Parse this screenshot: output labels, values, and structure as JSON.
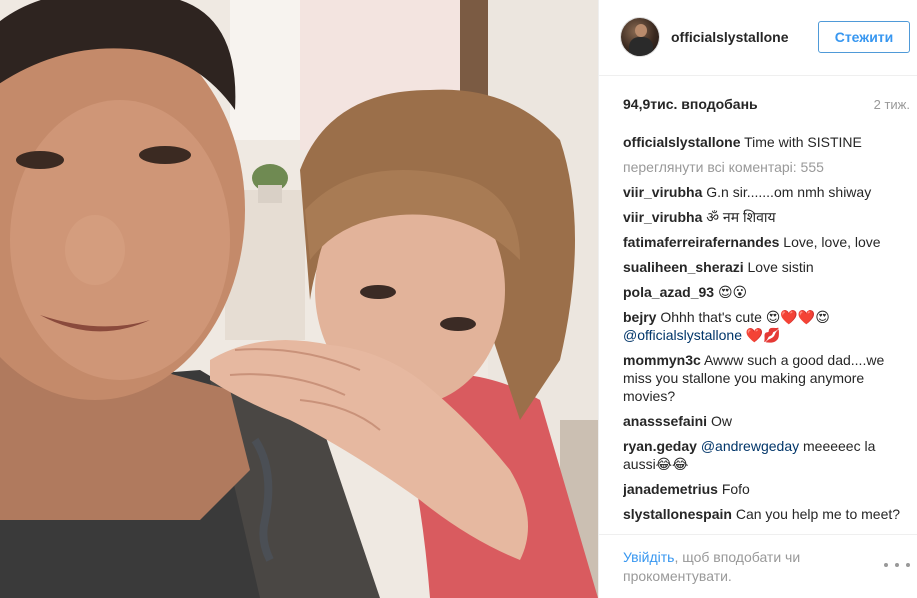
{
  "post": {
    "username": "officialslystallone",
    "follow_label": "Стежити",
    "likes": "94,9тис. вподобань",
    "time_ago": "2 тиж."
  },
  "comments": [
    {
      "user": "officialslystallone",
      "text": "Time with SISTINE"
    },
    {
      "view_all": "переглянути всі коментарі: 555"
    },
    {
      "user": "viir_virubha",
      "text": "G.n sir.......om nmh shiway"
    },
    {
      "user": "viir_virubha",
      "text": "ॐ नम शिवाय"
    },
    {
      "user": "fatimaferreirafernandes",
      "text": "Love, love, love"
    },
    {
      "user": "sualiheen_sherazi",
      "text": "Love sistin"
    },
    {
      "user": "pola_azad_93",
      "text": "😍😮"
    },
    {
      "user": "bejry",
      "text": "Ohhh that's cute 😍❤️❤️😍",
      "mention": "@officialslystallone",
      "after": "❤️💋"
    },
    {
      "user": "mommyn3c",
      "text": "Awww such a good dad....we miss you stallone you making anymore movies?"
    },
    {
      "user": "anasssefaini",
      "text": "Ow"
    },
    {
      "user": "ryan.geday",
      "mention": "@andrewgeday",
      "text": "meeeeec la aussi😂😂"
    },
    {
      "user": "janademetrius",
      "text": "Fofo"
    },
    {
      "user": "slystallonespain",
      "text": "Can you help me to meet? We're a club of Sylvester"
    }
  ],
  "footer": {
    "login_link": "Увійдіть",
    "login_rest": ", щоб вподобати чи прокоментувати."
  },
  "colors": {
    "accent": "#3897f0",
    "muted": "#999999",
    "text": "#262626"
  },
  "icons": {
    "more": "ellipsis-icon"
  }
}
